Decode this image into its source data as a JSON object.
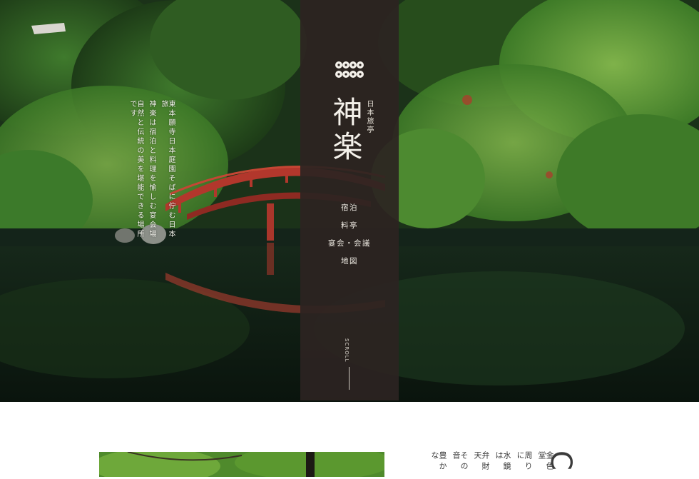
{
  "hero": {
    "tagline_lines": [
      "東本願寺日本庭園そばに佇む日本旅",
      "神楽は宿泊と料理を愉しむ宴会場",
      "自然と伝統の美を堪能できる場所です"
    ]
  },
  "panel": {
    "logo_icon": "four-circles-crest-icon",
    "brand": "神楽",
    "brand_sub": "日本旅亭",
    "nav": [
      "宿泊",
      "料亭",
      "宴会・会議",
      "地図"
    ],
    "scroll_label": "SCROLL"
  },
  "section2": {
    "text_lines": [
      "金色堂",
      "周りに",
      "水鏡は",
      "弁財天",
      "その音",
      "豊かな"
    ],
    "heading_partial": "C"
  },
  "colors": {
    "panel": "#2c2421",
    "bridge": "#b2372c",
    "foliage": "#3f7a2c",
    "water": "#0f1f14"
  }
}
